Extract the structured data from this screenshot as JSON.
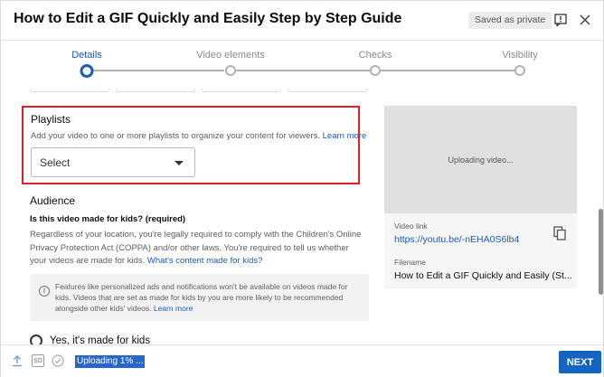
{
  "header": {
    "title": "How to Edit a GIF Quickly and Easily Step by Step Guide",
    "saved_badge": "Saved as private"
  },
  "stepper": {
    "steps": [
      {
        "label": "Details",
        "active": true
      },
      {
        "label": "Video elements",
        "active": false
      },
      {
        "label": "Checks",
        "active": false
      },
      {
        "label": "Visibility",
        "active": false
      }
    ]
  },
  "playlists": {
    "title": "Playlists",
    "description": "Add your video to one or more playlists to organize your content for viewers.",
    "learn_more": "Learn more",
    "select_value": "Select"
  },
  "audience": {
    "title": "Audience",
    "question": "Is this video made for kids? (required)",
    "body": "Regardless of your location, you're legally required to comply with the Children's Online Privacy Protection Act (COPPA) and/or other laws. You're required to tell us whether your videos are made for kids.",
    "link": "What's content made for kids?",
    "info_text": "Features like personalized ads and notifications won't be available on videos made for kids. Videos that are set as made for kids by you are more likely to be recommended alongside other kids' videos.",
    "info_link": "Learn more",
    "radio_yes": "Yes, it's made for kids"
  },
  "preview": {
    "uploading": "Uploading video...",
    "video_link_label": "Video link",
    "video_link": "https://youtu.be/-nEHA0S6lb4",
    "filename_label": "Filename",
    "filename": "How to Edit a GIF Quickly and Easily (St..."
  },
  "footer": {
    "sd_badge": "SD",
    "upload_status": "Uploading 1% ...",
    "next_label": "NEXT"
  },
  "colors": {
    "accent": "#1a5cb8",
    "highlight_border": "#e01f26",
    "next_button": "#1565c0"
  }
}
